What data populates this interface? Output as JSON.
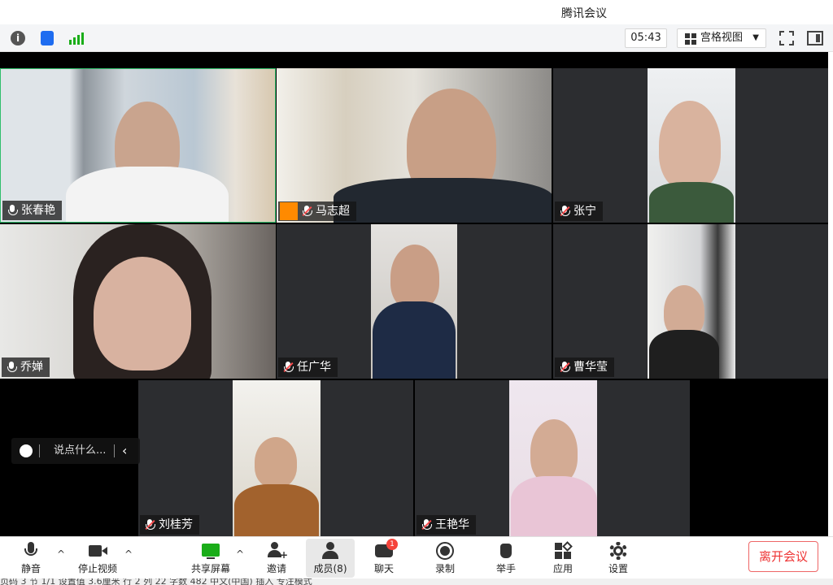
{
  "window": {
    "title": "腾讯会议"
  },
  "topbar": {
    "timer": "05:43",
    "view_label": "宫格视图"
  },
  "participants": [
    {
      "name": "张春艳",
      "muted": false
    },
    {
      "name": "马志超",
      "muted": true,
      "host": true
    },
    {
      "name": "张宁",
      "muted": true
    },
    {
      "name": "乔婵",
      "muted": false
    },
    {
      "name": "任广华",
      "muted": true
    },
    {
      "name": "曹华莹",
      "muted": true
    },
    {
      "name": "刘桂芳",
      "muted": true
    },
    {
      "name": "王艳华",
      "muted": true
    }
  ],
  "chat": {
    "placeholder": "说点什么..."
  },
  "toolbar": {
    "mute": "静音",
    "stop_video": "停止视频",
    "share_screen": "共享屏幕",
    "invite": "邀请",
    "members": "成员(8)",
    "chat": "聊天",
    "chat_badge": "1",
    "record": "录制",
    "raise_hand": "举手",
    "apps": "应用",
    "settings": "设置",
    "leave": "离开会议"
  },
  "statusbar": {
    "text": "页码 3   节 1/1   设置值 3.6厘米   行 2   列 22   字数 482   中文(中国)   插入   专注模式"
  }
}
